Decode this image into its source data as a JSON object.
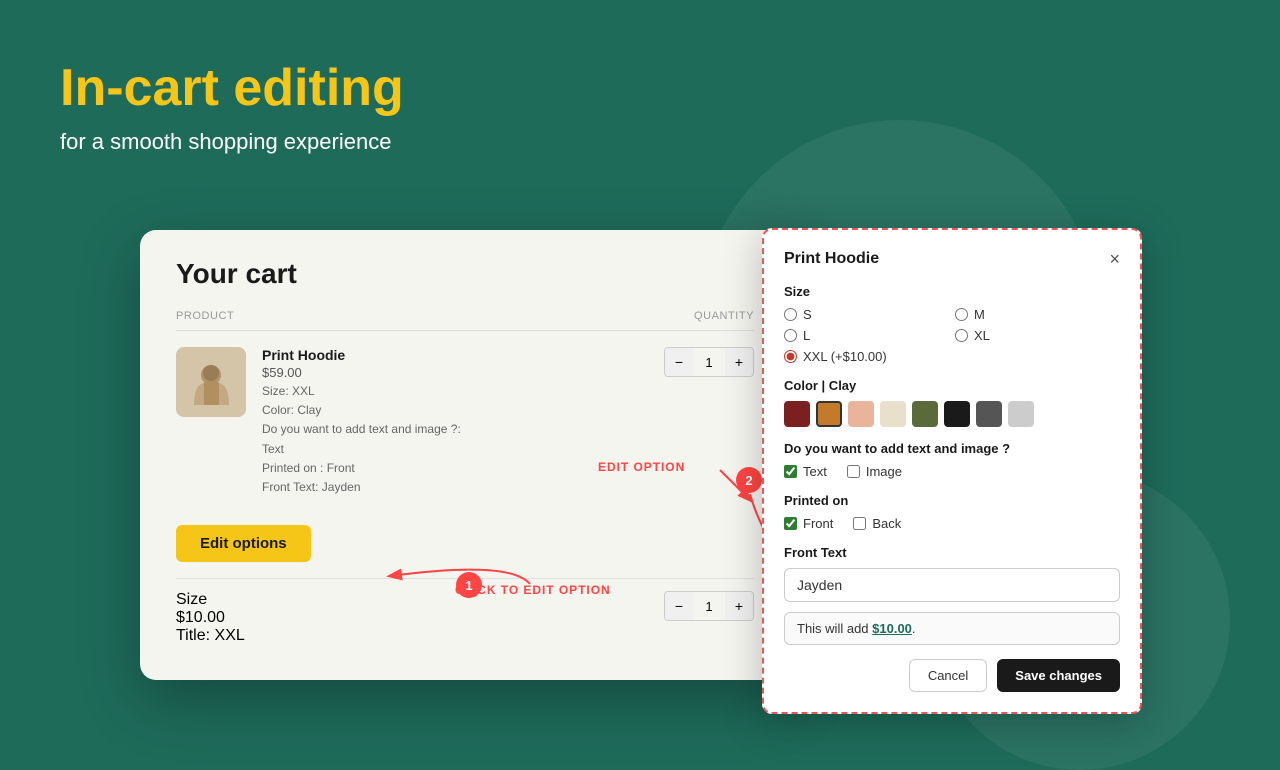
{
  "hero": {
    "title": "In-cart editing",
    "subtitle": "for a smooth shopping experience"
  },
  "cart": {
    "title": "Your cart",
    "header": {
      "product_label": "PRODUCT",
      "quantity_label": "QUANTITY"
    },
    "item1": {
      "name": "Print Hoodie",
      "price": "$59.00",
      "size": "Size: XXL",
      "color": "Color: Clay",
      "custom": "Do you want to add text and image ?:",
      "custom_val": "Text",
      "printed_on": "Printed on : Front",
      "front_text": "Front Text: Jayden",
      "qty": "1"
    },
    "item2": {
      "name": "Size",
      "price": "$10.00",
      "title_attr": "Title: XXL",
      "qty": "1"
    },
    "edit_options_label": "Edit options",
    "annotation_edit_option": "EDIT OPTION",
    "annotation_click": "CLICK TO EDIT OPTION"
  },
  "modal": {
    "title": "Print Hoodie",
    "close_icon": "×",
    "size_label": "Size",
    "sizes": [
      "S",
      "M",
      "L",
      "XL",
      "XXL (+$10.00)"
    ],
    "selected_size": "XXL (+$10.00)",
    "color_label": "Color | Clay",
    "colors": [
      {
        "name": "dark-red",
        "hex": "#7b2020"
      },
      {
        "name": "clay-orange",
        "hex": "#c47a2b"
      },
      {
        "name": "peach",
        "hex": "#e8b49a"
      },
      {
        "name": "cream",
        "hex": "#e8e0cc"
      },
      {
        "name": "olive",
        "hex": "#5a6a3a"
      },
      {
        "name": "black",
        "hex": "#1a1a1a"
      },
      {
        "name": "dark-gray",
        "hex": "#555555"
      },
      {
        "name": "light-gray",
        "hex": "#cccccc"
      }
    ],
    "selected_color": "clay-orange",
    "add_text_image_label": "Do you want to add text and image ?",
    "text_option_label": "Text",
    "image_option_label": "Image",
    "text_checked": true,
    "image_checked": false,
    "printed_on_label": "Printed on",
    "front_option_label": "Front",
    "back_option_label": "Back",
    "front_checked": true,
    "back_checked": false,
    "front_text_label": "Front Text",
    "front_text_value": "Jayden",
    "front_text_placeholder": "Jayden",
    "info_text": "This will add $10.00.",
    "info_price": "$10.00",
    "cancel_label": "Cancel",
    "save_label": "Save changes"
  },
  "badges": {
    "b1": "1",
    "b2": "2"
  }
}
